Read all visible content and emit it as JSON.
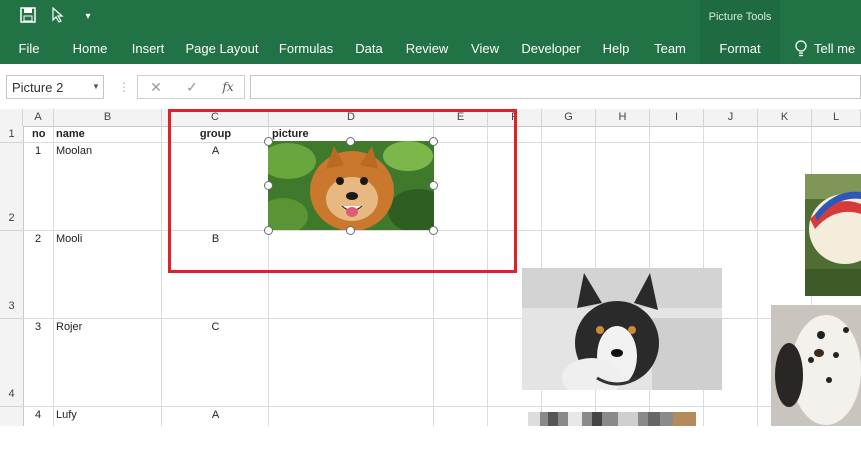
{
  "ribbon": {
    "contextual_label": "Picture Tools",
    "tabs": [
      "File",
      "Home",
      "Insert",
      "Page Layout",
      "Formulas",
      "Data",
      "Review",
      "View",
      "Developer",
      "Help",
      "Team",
      "Format"
    ],
    "tell_me": "Tell me"
  },
  "formula_bar": {
    "name_box": "Picture 2",
    "fx_label": "fx",
    "formula_value": ""
  },
  "columns": [
    "A",
    "B",
    "C",
    "D",
    "E",
    "F",
    "G",
    "H",
    "I",
    "J",
    "K",
    "L"
  ],
  "rows": [
    "1",
    "2",
    "3",
    "4"
  ],
  "sheet": {
    "headers": {
      "no": "no",
      "name": "name",
      "group": "group",
      "picture": "picture"
    },
    "records": [
      {
        "no": "1",
        "name": "Moolan",
        "group": "A"
      },
      {
        "no": "2",
        "name": "Mooli",
        "group": "B"
      },
      {
        "no": "3",
        "name": "Rojer",
        "group": "C"
      },
      {
        "no": "4",
        "name": "Lufy",
        "group": "A"
      }
    ]
  },
  "images": [
    "pomeranian-photo",
    "husky-photo",
    "white-dog-photo",
    "dalmatian-photo",
    "partial-photo"
  ],
  "colors": {
    "excel_green": "#217346",
    "selection_red": "#e0202a"
  }
}
